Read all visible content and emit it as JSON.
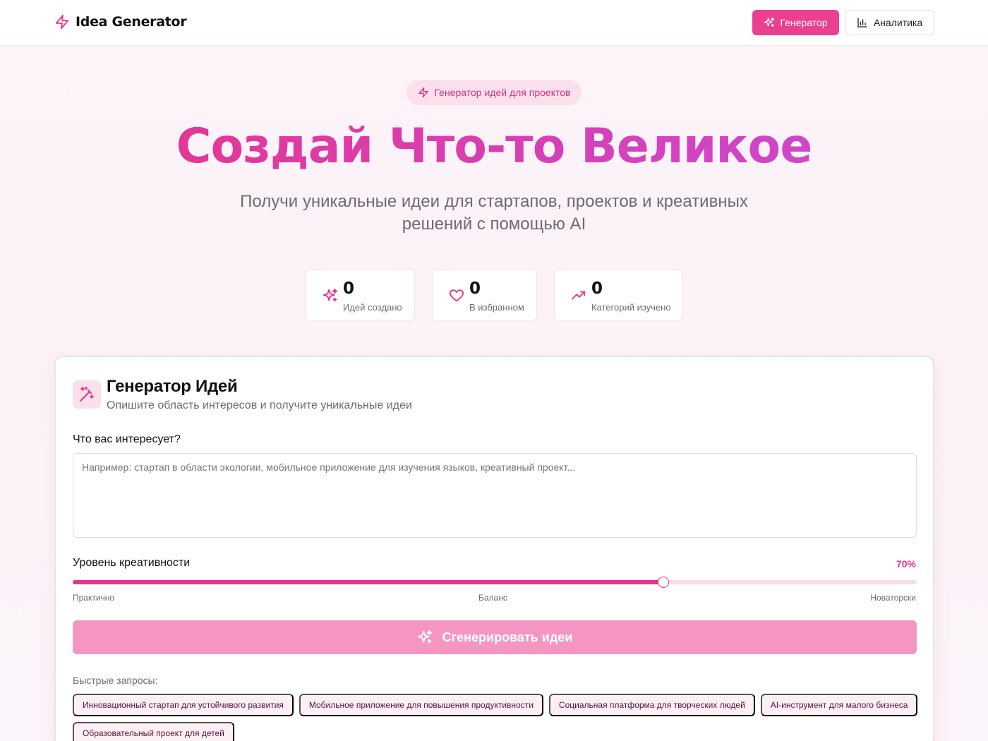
{
  "app": {
    "name": "Idea Generator"
  },
  "nav": {
    "generator_label": "Генератор",
    "analytics_label": "Аналитика"
  },
  "hero": {
    "badge": "Генератор идей для проектов",
    "title": "Создай Что-то Великое",
    "subtitle": "Получи уникальные идеи для стартапов, проектов и креативных решений с помощью AI"
  },
  "stats": [
    {
      "value": "0",
      "label": "Идей создано",
      "icon": "sparkles-icon"
    },
    {
      "value": "0",
      "label": "В избранном",
      "icon": "heart-icon"
    },
    {
      "value": "0",
      "label": "Категорий изучено",
      "icon": "trending-up-icon"
    }
  ],
  "generator": {
    "title": "Генератор Идей",
    "subtitle": "Опишите область интересов и получите уникальные идеи",
    "field_label": "Что вас интересует?",
    "placeholder": "Например: стартап в области экологии, мобильное приложение для изучения языков, креативный проект...",
    "creativity_label": "Уровень креативности",
    "creativity_value": 70,
    "creativity_display": "70%",
    "tick_left": "Практично",
    "tick_mid": "Баланс",
    "tick_right": "Новаторски",
    "button_label": "Сгенерировать идеи",
    "quick_label": "Быстрые запросы:",
    "quick": [
      "Инновационный стартап для устойчивого развития",
      "Мобильное приложение для повышения продуктивности",
      "Социальная платформа для творческих людей",
      "AI-инструмент для малого бизнеса",
      "Образовательный проект для детей"
    ]
  },
  "colors": {
    "accent": "#ec3f8f",
    "accent_soft": "#fbe0ec",
    "button_disabled": "#f596c2"
  }
}
